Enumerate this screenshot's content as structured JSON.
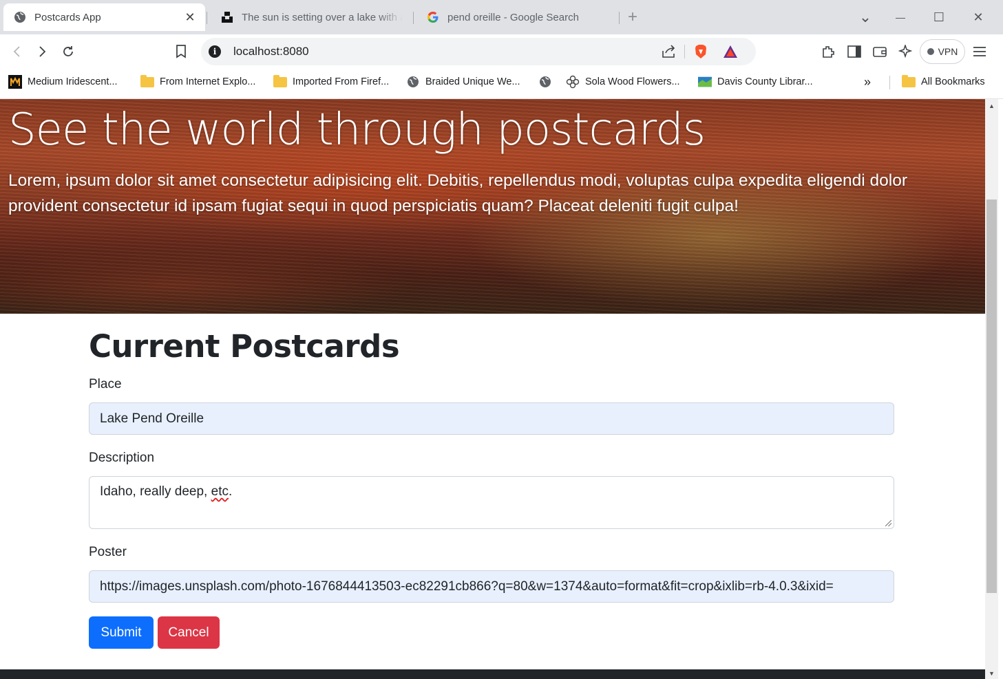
{
  "browser": {
    "tabs": [
      {
        "label": "Postcards App",
        "active": true,
        "icon": "globe-icon"
      },
      {
        "label": "The sun is setting over a lake with a",
        "active": false,
        "icon": "unsplash-icon"
      },
      {
        "label": "pend oreille - Google Search",
        "active": false,
        "icon": "google-icon"
      }
    ],
    "close_glyph": "✕",
    "new_tab_glyph": "+",
    "window_controls": {
      "tablist": "⌄",
      "minimize": "—",
      "maximize": "☐",
      "close": "✕"
    },
    "url": "localhost:8080",
    "vpn_label": "VPN",
    "bookmarks": [
      {
        "label": "Medium Iridescent...",
        "icon": "m-logo-icon"
      },
      {
        "label": "From Internet Explo...",
        "icon": "folder-icon"
      },
      {
        "label": "Imported From Firef...",
        "icon": "folder-icon"
      },
      {
        "label": "Braided Unique We...",
        "icon": "globe-icon"
      },
      {
        "label": "",
        "icon": "globe-icon"
      },
      {
        "label": "Sola Wood Flowers...",
        "icon": "flower-icon"
      },
      {
        "label": "Davis County Librar...",
        "icon": "library-icon"
      }
    ],
    "bookmarks_overflow": "»",
    "all_bookmarks": "All Bookmarks"
  },
  "hero": {
    "title": "See the world through postcards",
    "text": "Lorem, ipsum dolor sit amet consectetur adipisicing elit. Debitis, repellendus modi, voluptas culpa expedita eligendi dolor provident consectetur id ipsam fugiat sequi in quod perspiciatis quam? Placeat deleniti fugit culpa!"
  },
  "form": {
    "heading": "Current Postcards",
    "place_label": "Place",
    "place_value": "Lake Pend Oreille",
    "description_label": "Description",
    "description_value_pre": "Idaho, really deep, ",
    "description_value_misspelled": "etc",
    "description_value_post": ".",
    "poster_label": "Poster",
    "poster_value": "https://images.unsplash.com/photo-1676844413503-ec82291cb866?q=80&w=1374&auto=format&fit=crop&ixlib=rb-4.0.3&ixid=",
    "submit_label": "Submit",
    "cancel_label": "Cancel"
  },
  "colors": {
    "submit": "#0d6efd",
    "cancel": "#dc3545",
    "autofill_bg": "#e8f0fe",
    "footer": "#212529"
  }
}
